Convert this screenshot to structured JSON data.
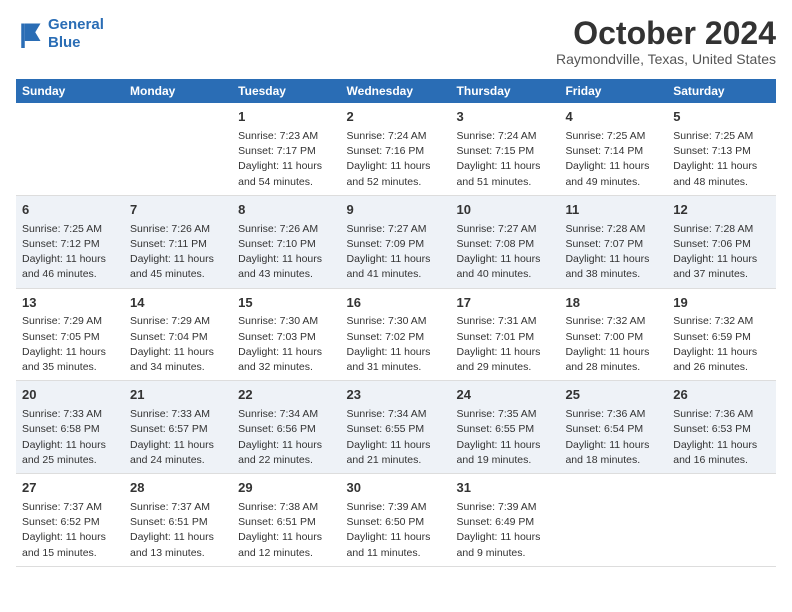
{
  "header": {
    "logo_line1": "General",
    "logo_line2": "Blue",
    "month_title": "October 2024",
    "location": "Raymondville, Texas, United States"
  },
  "columns": [
    "Sunday",
    "Monday",
    "Tuesday",
    "Wednesday",
    "Thursday",
    "Friday",
    "Saturday"
  ],
  "weeks": [
    [
      {
        "day": "",
        "info": ""
      },
      {
        "day": "",
        "info": ""
      },
      {
        "day": "1",
        "info": "Sunrise: 7:23 AM\nSunset: 7:17 PM\nDaylight: 11 hours and 54 minutes."
      },
      {
        "day": "2",
        "info": "Sunrise: 7:24 AM\nSunset: 7:16 PM\nDaylight: 11 hours and 52 minutes."
      },
      {
        "day": "3",
        "info": "Sunrise: 7:24 AM\nSunset: 7:15 PM\nDaylight: 11 hours and 51 minutes."
      },
      {
        "day": "4",
        "info": "Sunrise: 7:25 AM\nSunset: 7:14 PM\nDaylight: 11 hours and 49 minutes."
      },
      {
        "day": "5",
        "info": "Sunrise: 7:25 AM\nSunset: 7:13 PM\nDaylight: 11 hours and 48 minutes."
      }
    ],
    [
      {
        "day": "6",
        "info": "Sunrise: 7:25 AM\nSunset: 7:12 PM\nDaylight: 11 hours and 46 minutes."
      },
      {
        "day": "7",
        "info": "Sunrise: 7:26 AM\nSunset: 7:11 PM\nDaylight: 11 hours and 45 minutes."
      },
      {
        "day": "8",
        "info": "Sunrise: 7:26 AM\nSunset: 7:10 PM\nDaylight: 11 hours and 43 minutes."
      },
      {
        "day": "9",
        "info": "Sunrise: 7:27 AM\nSunset: 7:09 PM\nDaylight: 11 hours and 41 minutes."
      },
      {
        "day": "10",
        "info": "Sunrise: 7:27 AM\nSunset: 7:08 PM\nDaylight: 11 hours and 40 minutes."
      },
      {
        "day": "11",
        "info": "Sunrise: 7:28 AM\nSunset: 7:07 PM\nDaylight: 11 hours and 38 minutes."
      },
      {
        "day": "12",
        "info": "Sunrise: 7:28 AM\nSunset: 7:06 PM\nDaylight: 11 hours and 37 minutes."
      }
    ],
    [
      {
        "day": "13",
        "info": "Sunrise: 7:29 AM\nSunset: 7:05 PM\nDaylight: 11 hours and 35 minutes."
      },
      {
        "day": "14",
        "info": "Sunrise: 7:29 AM\nSunset: 7:04 PM\nDaylight: 11 hours and 34 minutes."
      },
      {
        "day": "15",
        "info": "Sunrise: 7:30 AM\nSunset: 7:03 PM\nDaylight: 11 hours and 32 minutes."
      },
      {
        "day": "16",
        "info": "Sunrise: 7:30 AM\nSunset: 7:02 PM\nDaylight: 11 hours and 31 minutes."
      },
      {
        "day": "17",
        "info": "Sunrise: 7:31 AM\nSunset: 7:01 PM\nDaylight: 11 hours and 29 minutes."
      },
      {
        "day": "18",
        "info": "Sunrise: 7:32 AM\nSunset: 7:00 PM\nDaylight: 11 hours and 28 minutes."
      },
      {
        "day": "19",
        "info": "Sunrise: 7:32 AM\nSunset: 6:59 PM\nDaylight: 11 hours and 26 minutes."
      }
    ],
    [
      {
        "day": "20",
        "info": "Sunrise: 7:33 AM\nSunset: 6:58 PM\nDaylight: 11 hours and 25 minutes."
      },
      {
        "day": "21",
        "info": "Sunrise: 7:33 AM\nSunset: 6:57 PM\nDaylight: 11 hours and 24 minutes."
      },
      {
        "day": "22",
        "info": "Sunrise: 7:34 AM\nSunset: 6:56 PM\nDaylight: 11 hours and 22 minutes."
      },
      {
        "day": "23",
        "info": "Sunrise: 7:34 AM\nSunset: 6:55 PM\nDaylight: 11 hours and 21 minutes."
      },
      {
        "day": "24",
        "info": "Sunrise: 7:35 AM\nSunset: 6:55 PM\nDaylight: 11 hours and 19 minutes."
      },
      {
        "day": "25",
        "info": "Sunrise: 7:36 AM\nSunset: 6:54 PM\nDaylight: 11 hours and 18 minutes."
      },
      {
        "day": "26",
        "info": "Sunrise: 7:36 AM\nSunset: 6:53 PM\nDaylight: 11 hours and 16 minutes."
      }
    ],
    [
      {
        "day": "27",
        "info": "Sunrise: 7:37 AM\nSunset: 6:52 PM\nDaylight: 11 hours and 15 minutes."
      },
      {
        "day": "28",
        "info": "Sunrise: 7:37 AM\nSunset: 6:51 PM\nDaylight: 11 hours and 13 minutes."
      },
      {
        "day": "29",
        "info": "Sunrise: 7:38 AM\nSunset: 6:51 PM\nDaylight: 11 hours and 12 minutes."
      },
      {
        "day": "30",
        "info": "Sunrise: 7:39 AM\nSunset: 6:50 PM\nDaylight: 11 hours and 11 minutes."
      },
      {
        "day": "31",
        "info": "Sunrise: 7:39 AM\nSunset: 6:49 PM\nDaylight: 11 hours and 9 minutes."
      },
      {
        "day": "",
        "info": ""
      },
      {
        "day": "",
        "info": ""
      }
    ]
  ]
}
